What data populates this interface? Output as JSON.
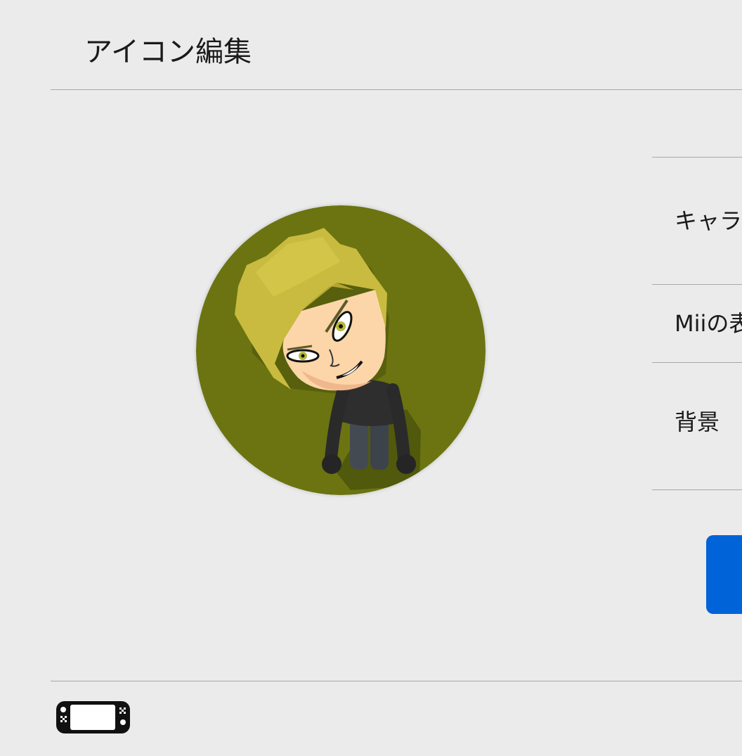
{
  "header": {
    "title": "アイコン編集"
  },
  "avatar": {
    "background_color": "#6b7411",
    "description_icon": "mii-character-icon"
  },
  "menu": {
    "items": [
      {
        "label": "キャラ"
      },
      {
        "label": "Miiの表"
      },
      {
        "label": "背景"
      }
    ]
  },
  "actions": {
    "primary_button_color": "#0063d8"
  },
  "footer": {
    "console_icon": "handheld-console-icon"
  }
}
